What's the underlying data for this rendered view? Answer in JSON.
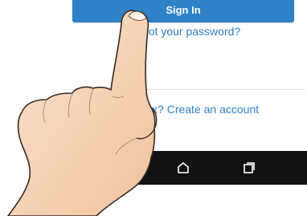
{
  "login": {
    "signin_label": "Sign In",
    "forgot_link": "Forgot your password?",
    "create_account_link": "No Inbox? Create an account"
  },
  "navbar": {
    "home_icon": "home-icon",
    "recents_icon": "recents-icon"
  },
  "colors": {
    "accent": "#2f82c8",
    "navbar": "#121212",
    "skin": "#f6d3b3"
  }
}
